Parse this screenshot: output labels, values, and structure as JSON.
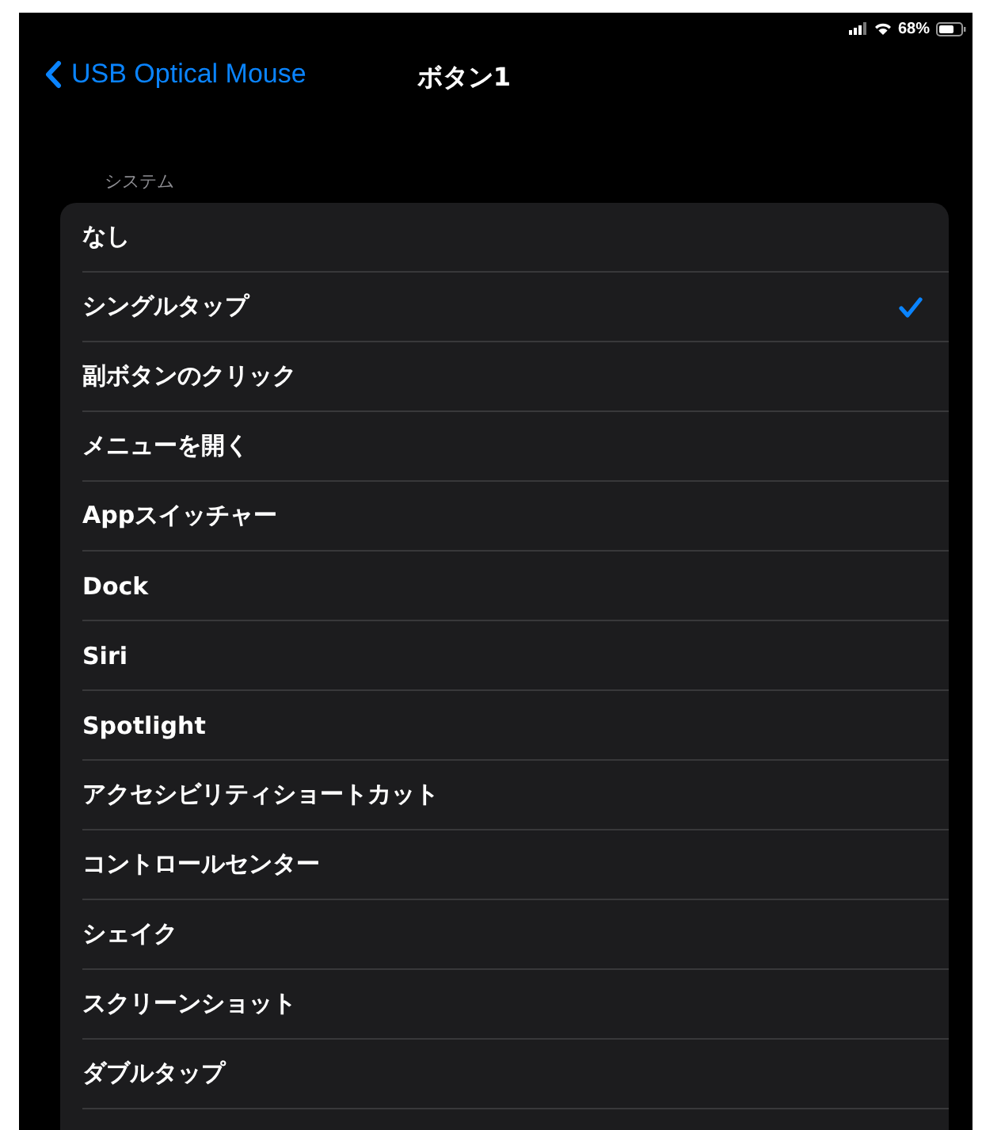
{
  "status_bar": {
    "battery": "68%"
  },
  "nav": {
    "back": "USB Optical Mouse",
    "title": "ボタン1"
  },
  "section": {
    "header": "システム",
    "items": [
      {
        "label": "なし",
        "selected": false
      },
      {
        "label": "シングルタップ",
        "selected": true
      },
      {
        "label": "副ボタンのクリック",
        "selected": false
      },
      {
        "label": "メニューを開く",
        "selected": false
      },
      {
        "label": "Appスイッチャー",
        "selected": false
      },
      {
        "label": "Dock",
        "selected": false
      },
      {
        "label": "Siri",
        "selected": false
      },
      {
        "label": "Spotlight",
        "selected": false
      },
      {
        "label": "アクセシビリティショートカット",
        "selected": false
      },
      {
        "label": "コントロールセンター",
        "selected": false
      },
      {
        "label": "シェイク",
        "selected": false
      },
      {
        "label": "スクリーンショット",
        "selected": false
      },
      {
        "label": "ダブルタップ",
        "selected": false
      }
    ]
  }
}
